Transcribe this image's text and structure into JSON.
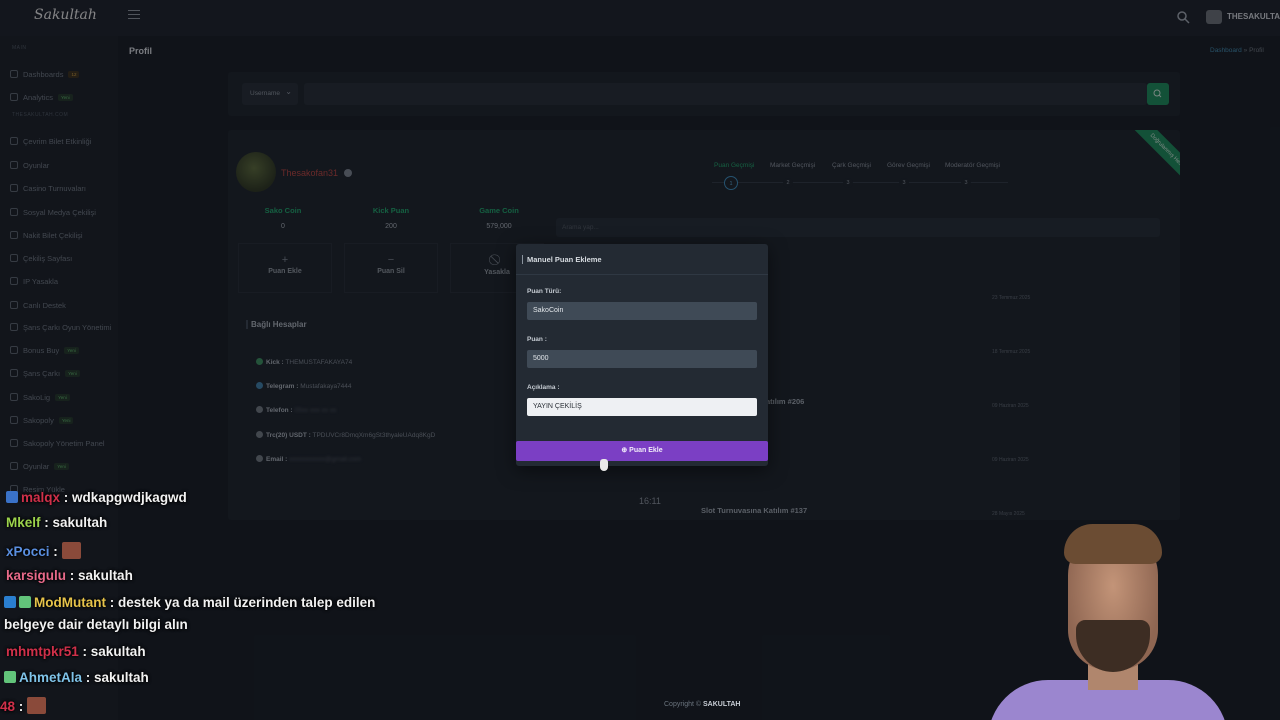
{
  "app": {
    "logo": "Sakultah",
    "user": "THESAKULTAH"
  },
  "sidebar": {
    "cat_main": "MAIN",
    "cat_section": "THESAKULTAH.COM",
    "items": [
      {
        "label": "Dashboards",
        "badge": "12",
        "badge_type": "num"
      },
      {
        "label": "Analytics",
        "badge": "Yeni"
      },
      {
        "label": "Çevrim Bilet Etkinliği"
      },
      {
        "label": "Oyunlar"
      },
      {
        "label": "Casino Turnuvaları"
      },
      {
        "label": "Sosyal Medya Çekilişi"
      },
      {
        "label": "Nakit Bilet Çekilişi"
      },
      {
        "label": "Çekiliş Sayfası"
      },
      {
        "label": "IP Yasakla"
      },
      {
        "label": "Canlı Destek"
      },
      {
        "label": "Şans Çarkı Oyun Yönetimi"
      },
      {
        "label": "Bonus Buy",
        "badge": "Yeni"
      },
      {
        "label": "Şans Çarkı",
        "badge": "Yeni"
      },
      {
        "label": "SakoLig",
        "badge": "Yeni"
      },
      {
        "label": "Sakopoly",
        "badge": "Yeni"
      },
      {
        "label": "Sakopoly Yönetim Panel"
      },
      {
        "label": "Oyunlar",
        "badge": "Yeni"
      },
      {
        "label": "Resim Yükle"
      }
    ]
  },
  "page": {
    "title": "Profil",
    "breadcrumb_home": "Dashboard",
    "breadcrumb_sep": "»",
    "breadcrumb_current": "Profil"
  },
  "search": {
    "select_label": "Username"
  },
  "profile": {
    "name": "Thesakofan31",
    "stats": [
      {
        "label": "Sako Coin",
        "value": "0"
      },
      {
        "label": "Kick Puan",
        "value": "200"
      },
      {
        "label": "Game Coin",
        "value": "579,000"
      }
    ],
    "actions": [
      {
        "icon": "+",
        "label": "Puan Ekle"
      },
      {
        "icon": "−",
        "label": "Puan Sil"
      },
      {
        "icon": "⃠",
        "label": "Yasakla"
      }
    ],
    "linked_title": "Bağlı Hesaplar",
    "linked": [
      {
        "key": "Kick :",
        "value": "THEMUSTAFAKAYA74"
      },
      {
        "key": "Telegram :",
        "value": "Mustafakaya7444"
      },
      {
        "key": "Telefon :",
        "value": "05xx xxx xx xx"
      },
      {
        "key": "Trc(20) USDT :",
        "value": "TPDUVCr8DmqXm6gSt3thyaleUAdq8KgD"
      },
      {
        "key": "Email :",
        "value": "xxxxxxxxxxx@gmail.com"
      }
    ]
  },
  "tabs": [
    {
      "label": "Puan Geçmişi",
      "num": "1"
    },
    {
      "label": "Market Geçmişi",
      "num": "2"
    },
    {
      "label": "Çark Geçmişi",
      "num": "3"
    },
    {
      "label": "Görev Geçmişi",
      "num": "3"
    },
    {
      "label": "Moderatör Geçmişi",
      "num": "3"
    }
  ],
  "ribbon": "Doğrulanmış Hesap",
  "log": {
    "search_placeholder": "Arama yap...",
    "dates": [
      "23 Temmuz 2025",
      "18 Temmuz 2025",
      "09 Haziran 2025",
      "09 Haziran 2025",
      "28 Mayıs 2025"
    ],
    "entry_1": "atılım #206",
    "entry_2": "Slot Turnuvasına Katılım #137",
    "time": "16:11"
  },
  "modal": {
    "title": "Manuel Puan Ekleme",
    "type_label": "Puan Türü:",
    "type_value": "SakoCoin",
    "amount_label": "Puan :",
    "amount_value": "5000",
    "desc_label": "Açıklama :",
    "desc_value": "YAYIN ÇEKİLİŞ",
    "submit": "Puan Ekle"
  },
  "chat": [
    {
      "user": "malqx",
      "color": "#d0304a",
      "text": ": wdkapgwdjkagwd"
    },
    {
      "user": "Mkelf",
      "color": "#9cd34c",
      "text": ": sakultah"
    },
    {
      "user": "xPocci",
      "color": "#5a8fe0",
      "text": ":"
    },
    {
      "user": "karsigulu",
      "color": "#e86a8a",
      "text": ": sakultah"
    },
    {
      "user": "ModMutant",
      "color": "#e6c34a",
      "text": ": destek ya da mail üzerinden talep edilen"
    },
    {
      "user": "",
      "color": "#f2f2f2",
      "text": "belgeye dair detaylı bilgi alın"
    },
    {
      "user": "mhmtpkr51",
      "color": "#d0304a",
      "text": ": sakultah"
    },
    {
      "user": "AhmetAla",
      "color": "#7fc3e8",
      "text": ": sakultah"
    },
    {
      "user": "48",
      "color": "#d0304a",
      "text": ":"
    }
  ],
  "footer": {
    "prefix": "Copyright ©",
    "brand": "SAKULTAH"
  }
}
